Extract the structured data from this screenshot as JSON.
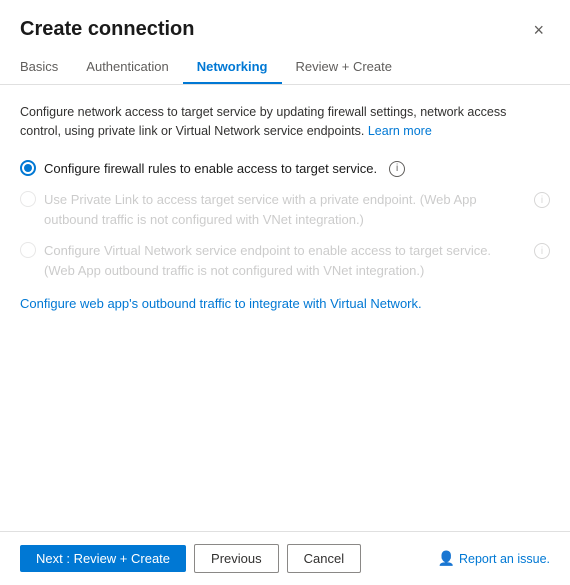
{
  "dialog": {
    "title": "Create connection",
    "close_label": "×"
  },
  "tabs": [
    {
      "id": "basics",
      "label": "Basics",
      "active": false
    },
    {
      "id": "authentication",
      "label": "Authentication",
      "active": false
    },
    {
      "id": "networking",
      "label": "Networking",
      "active": true
    },
    {
      "id": "review-create",
      "label": "Review + Create",
      "active": false
    }
  ],
  "content": {
    "description": "Configure network access to target service by updating firewall settings, network access control, using private link or Virtual Network service endpoints.",
    "learn_more": "Learn more",
    "options": [
      {
        "id": "firewall",
        "label": "Configure firewall rules to enable access to target service.",
        "selected": true,
        "disabled": false,
        "has_info": true
      },
      {
        "id": "private-link",
        "label": "Use Private Link to access target service with a private endpoint. (Web App outbound traffic is not configured with VNet integration.)",
        "selected": false,
        "disabled": true,
        "has_info": true
      },
      {
        "id": "vnet-endpoint",
        "label": "Configure Virtual Network service endpoint to enable access to target service. (Web App outbound traffic is not configured with VNet integration.)",
        "selected": false,
        "disabled": true,
        "has_info": true
      }
    ],
    "vnet_link_text": "Configure web app's outbound traffic to integrate with Virtual Network."
  },
  "footer": {
    "next_label": "Next : Review + Create",
    "previous_label": "Previous",
    "cancel_label": "Cancel",
    "report_label": "Report an issue."
  }
}
